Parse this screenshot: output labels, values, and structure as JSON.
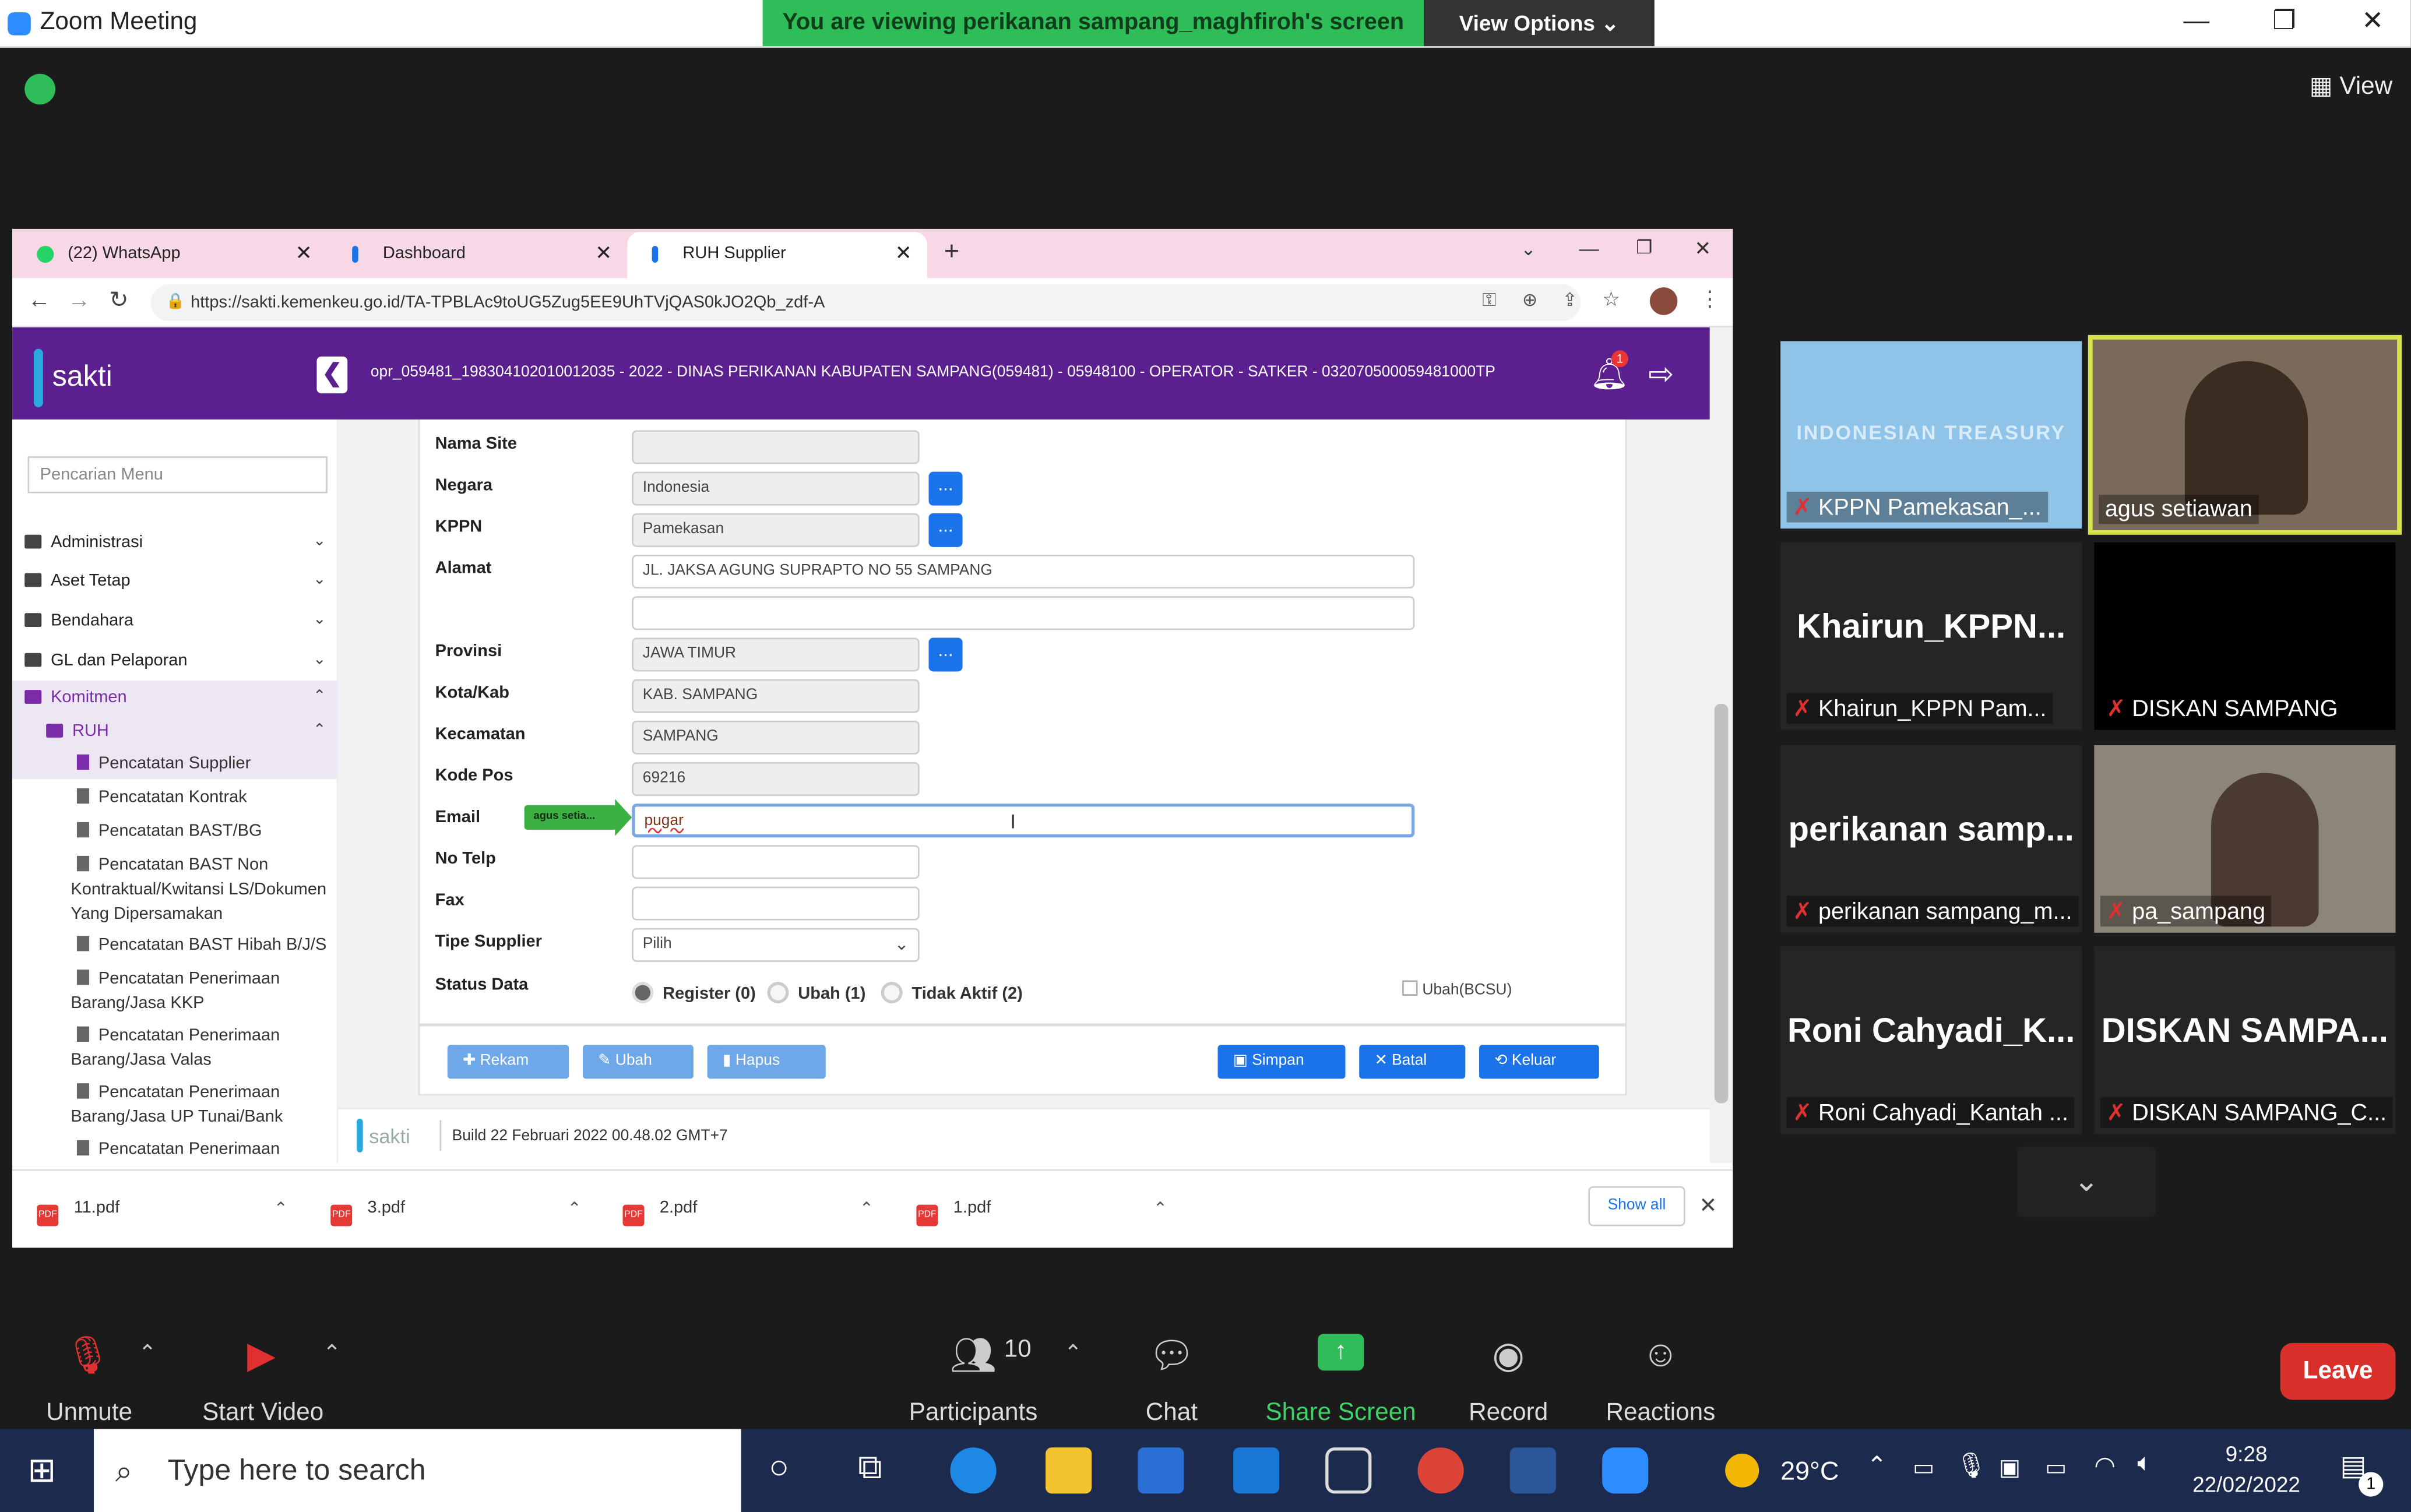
{
  "zoom": {
    "window_title": "Zoom Meeting",
    "viewing_banner": "You are viewing perikanan sampang_maghfiroh's screen",
    "view_options": "View Options",
    "view_button": "View"
  },
  "browser": {
    "tabs": [
      {
        "label": "(22) WhatsApp",
        "favicon_color": "#25d366"
      },
      {
        "label": "Dashboard",
        "favicon_color": "#1a73e8"
      },
      {
        "label": "RUH Supplier",
        "favicon_color": "#1a73e8"
      }
    ],
    "url": "https://sakti.kemenkeu.go.id/TA-TPBLAc9toUG5Zug5EE9UhTVjQAS0kJO2Qb_zdf-A"
  },
  "sakti": {
    "logo": "sakti",
    "header_info": "opr_059481_198304102010012035 - 2022 - DINAS PERIKANAN KABUPATEN SAMPANG(059481) - 05948100 - OPERATOR - SATKER - 032070500059481000TP",
    "notification_count": "1",
    "search_placeholder": "Pencarian Menu",
    "menu": [
      "Administrasi",
      "Aset Tetap",
      "Bendahara",
      "GL dan Pelaporan",
      "Komitmen"
    ],
    "submenu": "RUH",
    "leaves": [
      "Pencatatan Supplier",
      "Pencatatan Kontrak",
      "Pencatatan BAST/BG",
      "Pencatatan BAST Non Kontraktual/Kwitansi LS/Dokumen Yang Dipersamakan",
      "Pencatatan BAST Hibah B/J/S",
      "Pencatatan Penerimaan Barang/Jasa KKP",
      "Pencatatan Penerimaan Barang/Jasa Valas",
      "Pencatatan Penerimaan Barang/Jasa UP Tunai/Bank",
      "Pencatatan Penerimaan"
    ],
    "form": {
      "nama_site_label": "Nama Site",
      "nama_site": "",
      "negara_label": "Negara",
      "negara": "Indonesia",
      "kppn_label": "KPPN",
      "kppn": "Pamekasan",
      "alamat_label": "Alamat",
      "alamat": "JL. JAKSA AGUNG SUPRAPTO NO 55 SAMPANG",
      "alamat2": "",
      "provinsi_label": "Provinsi",
      "provinsi": "JAWA TIMUR",
      "kota_label": "Kota/Kab",
      "kota": "KAB. SAMPANG",
      "kecamatan_label": "Kecamatan",
      "kecamatan": "SAMPANG",
      "kodepos_label": "Kode Pos",
      "kodepos": "69216",
      "email_label": "Email",
      "email": "pugar",
      "telp_label": "No Telp",
      "telp": "",
      "fax_label": "Fax",
      "fax": "",
      "tipe_label": "Tipe Supplier",
      "tipe": "Pilih",
      "status_label": "Status Data",
      "status_options": [
        "Register (0)",
        "Ubah (1)",
        "Tidak Aktif (2)"
      ],
      "ubah_bcsu": "Ubah(BCSU)",
      "dots": "..."
    },
    "annotation_arrow": "agus setia...",
    "buttons": {
      "rekam": "Rekam",
      "ubah": "Ubah",
      "hapus": "Hapus",
      "simpan": "Simpan",
      "batal": "Batal",
      "keluar": "Keluar"
    },
    "build": "Build 22 Februari 2022 00.48.02 GMT+7"
  },
  "downloads": {
    "files": [
      "11.pdf",
      "3.pdf",
      "2.pdf",
      "1.pdf"
    ],
    "show_all": "Show all",
    "pdf_badge": "PDF"
  },
  "participants": [
    {
      "big": "",
      "name": "KPPN Pamekasan_...",
      "muted": true
    },
    {
      "big": "",
      "name": "agus setiawan",
      "muted": false
    },
    {
      "big": "Khairun_KPPN...",
      "name": "Khairun_KPPN Pam...",
      "muted": true
    },
    {
      "big": "",
      "name": "DISKAN SAMPANG",
      "muted": true
    },
    {
      "big": "perikanan  samp...",
      "name": "perikanan sampang_m...",
      "muted": true
    },
    {
      "big": "",
      "name": "pa_sampang",
      "muted": true
    },
    {
      "big": "Roni  Cahyadi_K...",
      "name": "Roni Cahyadi_Kantah ...",
      "muted": true
    },
    {
      "big": "DISKAN  SAMPA...",
      "name": "DISKAN SAMPANG_C...",
      "muted": true
    }
  ],
  "toolbar": {
    "unmute": "Unmute",
    "start_video": "Start Video",
    "participants": "Participants",
    "participants_count": "10",
    "chat": "Chat",
    "share_screen": "Share Screen",
    "record": "Record",
    "reactions": "Reactions",
    "leave": "Leave"
  },
  "taskbar": {
    "search_placeholder": "Type here to search",
    "weather": "29°C",
    "time": "9:28",
    "date": "22/02/2022",
    "notif_count": "1"
  }
}
